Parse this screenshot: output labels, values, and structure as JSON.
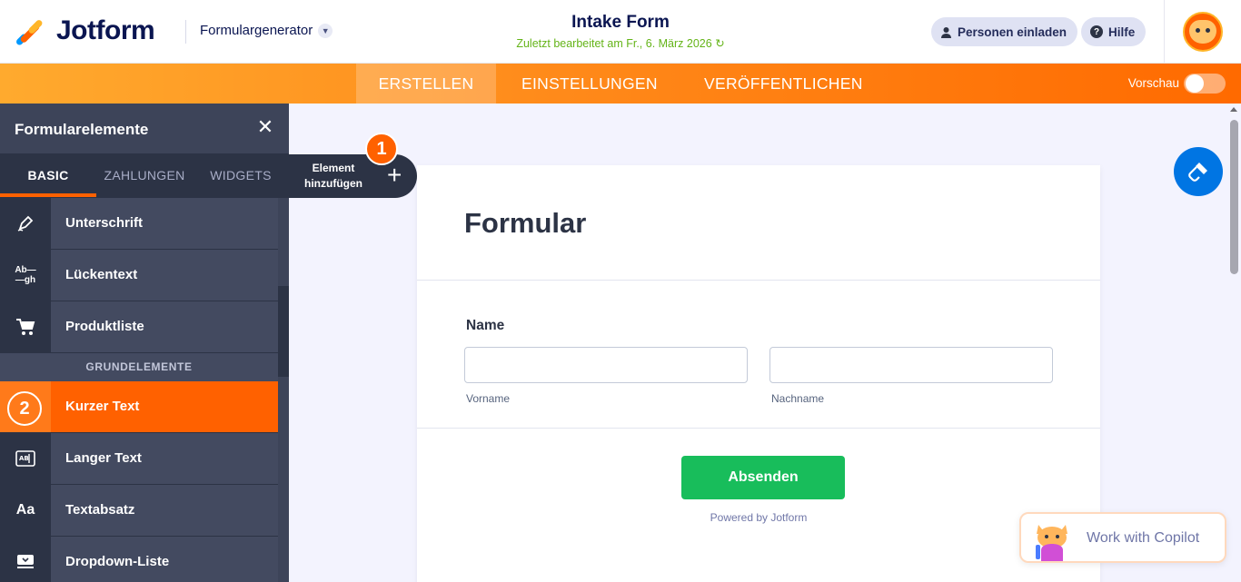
{
  "header": {
    "logo_text": "Jotform",
    "generator_label": "Formulargenerator",
    "form_title": "Intake Form",
    "last_edited": "Zuletzt bearbeitet am Fr., 6. März 2026",
    "invite_label": "Personen einladen",
    "help_label": "Hilfe"
  },
  "nav": {
    "tabs": [
      {
        "label": "ERSTELLEN",
        "active": true
      },
      {
        "label": "EINSTELLUNGEN",
        "active": false
      },
      {
        "label": "VERÖFFENTLICHEN",
        "active": false
      }
    ],
    "preview_label": "Vorschau",
    "preview_on": false
  },
  "sidebar": {
    "title": "Formularelemente",
    "tabs": [
      {
        "label": "BASIC",
        "active": true
      },
      {
        "label": "ZAHLUNGEN",
        "active": false
      },
      {
        "label": "WIDGETS",
        "active": false
      }
    ],
    "items_top": [
      {
        "label": "Unterschrift",
        "icon": "signature-pen-icon"
      },
      {
        "label": "Lückentext",
        "icon": "fill-in-blank-icon",
        "icon_text": "Ab—\n—gh"
      },
      {
        "label": "Produktliste",
        "icon": "shopping-cart-icon"
      }
    ],
    "section_label": "GRUNDELEMENTE",
    "items_bottom": [
      {
        "label": "Kurzer Text",
        "icon": "step-2-badge",
        "active": true,
        "badge": "2"
      },
      {
        "label": "Langer Text",
        "icon": "long-text-icon"
      },
      {
        "label": "Textabsatz",
        "icon": "paragraph-icon",
        "icon_text": "Aa"
      },
      {
        "label": "Dropdown-Liste",
        "icon": "dropdown-icon"
      }
    ]
  },
  "add_element": {
    "label_line1": "Element",
    "label_line2": "hinzufügen",
    "badge": "1"
  },
  "form": {
    "heading": "Formular",
    "field_label": "Name",
    "first_sublabel": "Vorname",
    "last_sublabel": "Nachname",
    "first_value": "",
    "last_value": "",
    "submit_label": "Absenden",
    "powered_by": "Powered by Jotform"
  },
  "copilot": {
    "label": "Work with Copilot"
  },
  "colors": {
    "brand_orange": "#ff6100",
    "sidebar_dark": "#2c3345",
    "submit_green": "#18bd5b",
    "edited_green": "#64b418",
    "designer_blue": "#0075e3"
  }
}
